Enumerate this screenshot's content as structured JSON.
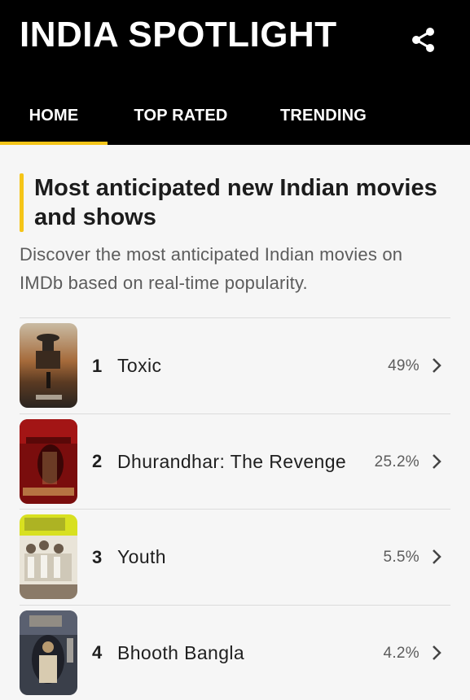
{
  "header": {
    "title": "INDIA SPOTLIGHT",
    "share_icon": "share-icon",
    "tabs": [
      {
        "label": "HOME",
        "active": true
      },
      {
        "label": "TOP RATED",
        "active": false
      },
      {
        "label": "TRENDING",
        "active": false
      }
    ]
  },
  "section": {
    "title": "Most anticipated new Indian movies and shows",
    "description": "Discover the most anticipated Indian movies on IMDb based on real-time popularity."
  },
  "movies": [
    {
      "rank": "1",
      "title": "Toxic",
      "percent": "49%"
    },
    {
      "rank": "2",
      "title": "Dhurandhar: The Revenge",
      "percent": "25.2%"
    },
    {
      "rank": "3",
      "title": "Youth",
      "percent": "5.5%"
    },
    {
      "rank": "4",
      "title": "Bhooth Bangla",
      "percent": "4.2%"
    }
  ],
  "colors": {
    "accent": "#f5c518",
    "header_bg": "#000000"
  }
}
